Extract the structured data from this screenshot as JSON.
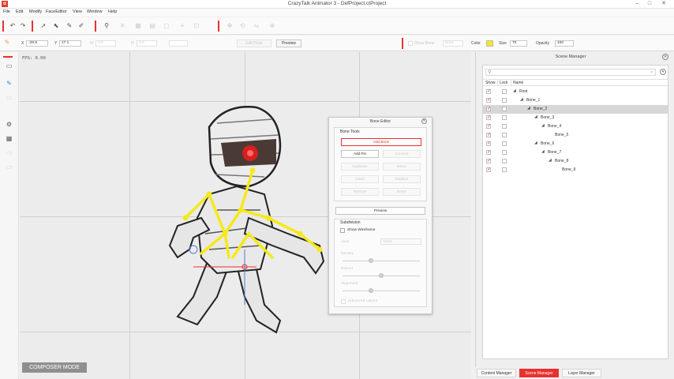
{
  "window": {
    "title": "CrazyTalk Animator 3  -  DefProject.ctProject",
    "app_icon_glyph": "α",
    "minimize_glyph": "–",
    "maximize_glyph": "□",
    "close_glyph": "✕"
  },
  "menu": [
    "File",
    "Edit",
    "Modify",
    "FaceEditor",
    "View",
    "Window",
    "Help"
  ],
  "toolbar2": {
    "x_label": "X",
    "x_value": "-29.9",
    "y_label": "Y",
    "y_value": "17.1",
    "w_label": "W",
    "w_value": "0.0",
    "h_label": "H",
    "h_value": "0.0",
    "edit_pose_label": "Edit Pose",
    "preview_label": "Preview",
    "show_bone_label": "Show Bone",
    "bone_mode_value": "Bone",
    "color_label": "Color",
    "color_value": "#f5e91a",
    "size_label": "Size",
    "size_value": "70",
    "opacity_label": "Opacity",
    "opacity_value": "100"
  },
  "stage": {
    "fps_text": "FPS: 0.00",
    "composer_mode_label": "COMPOSER MODE"
  },
  "bone_editor": {
    "title": "Bone Editor",
    "close_glyph": "✕",
    "bone_tools_title": "Bone Tools",
    "add_bone_label": "Add Bone",
    "add_pin_label": "Add Pin",
    "connect_label": "Connect",
    "duplicate_label": "Duplicate",
    "mirror_label": "Mirror",
    "insert_label": "Insert",
    "replace_label": "Replace",
    "remove_label": "Remove",
    "reset_label": "Reset",
    "preview_label": "Preview",
    "subdivision_title": "Subdivision",
    "show_wireframe_label": "Show Wireframe",
    "view_label": "View",
    "view_value": "Mesh",
    "density_label": "Density",
    "density_value": 0.37,
    "extend_label": "Extend",
    "extend_value": 0.5,
    "alignment_label": "Alignment",
    "alignment_value": 0.37,
    "advanced_layout_label": "Advanced Layout"
  },
  "scene_manager": {
    "title": "Scene Manager",
    "close_glyph": "✕",
    "search_placeholder": "",
    "columns": {
      "show": "Show",
      "lock": "Lock",
      "name": "Name"
    },
    "tree": [
      {
        "name": "Root",
        "depth": 0,
        "shown": true,
        "arrow": "◢"
      },
      {
        "name": "Bone_1",
        "depth": 1,
        "shown": true,
        "arrow": "◢"
      },
      {
        "name": "Bone_2",
        "depth": 2,
        "shown": true,
        "arrow": "◢",
        "selected": true
      },
      {
        "name": "Bone_3",
        "depth": 3,
        "shown": true,
        "arrow": "◢"
      },
      {
        "name": "Bone_4",
        "depth": 4,
        "shown": true,
        "arrow": "◢"
      },
      {
        "name": "Bone_5",
        "depth": 5,
        "shown": true,
        "arrow": ""
      },
      {
        "name": "Bone_6",
        "depth": 3,
        "shown": true,
        "arrow": "◢"
      },
      {
        "name": "Bone_7",
        "depth": 4,
        "shown": true,
        "arrow": "◢"
      },
      {
        "name": "Bone_8",
        "depth": 5,
        "shown": true,
        "arrow": "◢"
      },
      {
        "name": "Bone_9",
        "depth": 6,
        "shown": true,
        "arrow": ""
      }
    ]
  },
  "bottom_tabs": [
    {
      "label": "Content Manager",
      "active": false
    },
    {
      "label": "Scene Manager",
      "active": true
    },
    {
      "label": "Layer Manager",
      "active": false
    }
  ],
  "colors": {
    "accent": "#e8312f",
    "bone": "#f5e91a",
    "selection": "#d7d7d7"
  }
}
